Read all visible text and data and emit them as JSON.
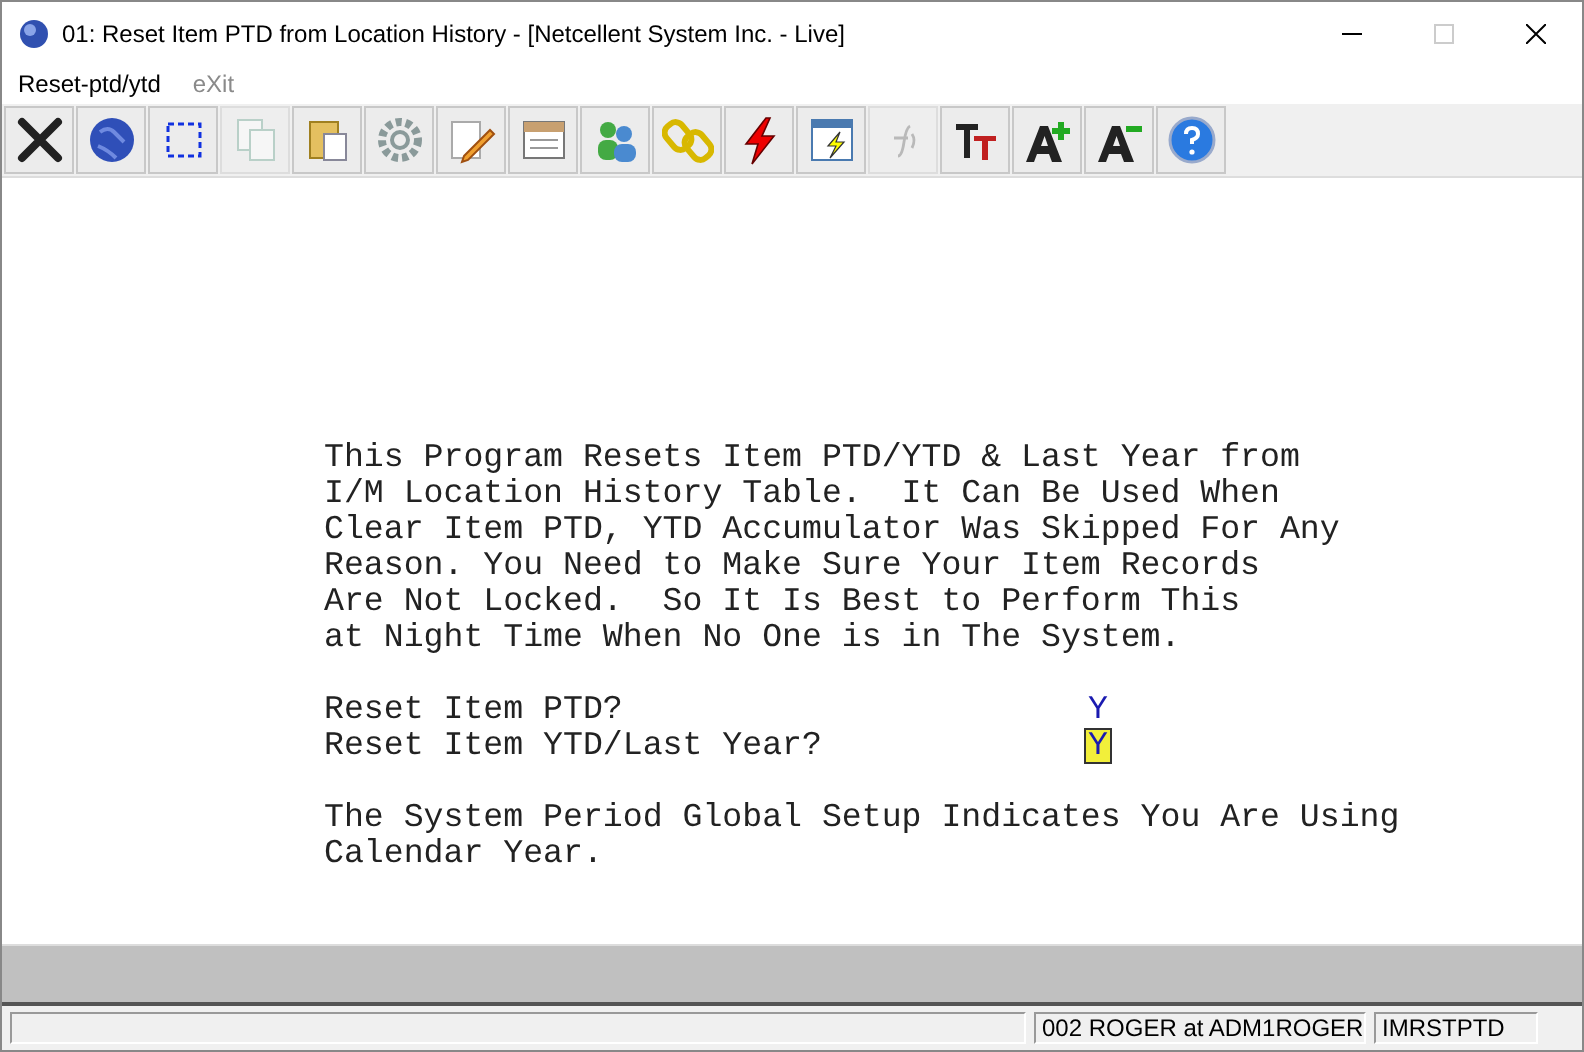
{
  "window": {
    "title": "01: Reset Item PTD from Location History - [Netcellent System Inc. - Live]"
  },
  "menu": [
    {
      "label": "Reset-ptd/ytd",
      "disabled": false
    },
    {
      "label": "eXit",
      "disabled": true
    }
  ],
  "toolbar": [
    {
      "kind": "close",
      "disabled": false
    },
    {
      "kind": "globe",
      "disabled": false
    },
    {
      "kind": "select",
      "disabled": false
    },
    {
      "kind": "copy",
      "disabled": true
    },
    {
      "kind": "paste",
      "disabled": false
    },
    {
      "kind": "gear",
      "disabled": false
    },
    {
      "kind": "edit",
      "disabled": false
    },
    {
      "kind": "notes",
      "disabled": false
    },
    {
      "kind": "users",
      "disabled": false
    },
    {
      "kind": "link",
      "disabled": false
    },
    {
      "kind": "bolt",
      "disabled": false
    },
    {
      "kind": "run",
      "disabled": false
    },
    {
      "kind": "fx",
      "disabled": true
    },
    {
      "kind": "font",
      "disabled": false
    },
    {
      "kind": "grow",
      "disabled": false
    },
    {
      "kind": "shrink",
      "disabled": false
    },
    {
      "kind": "help",
      "disabled": false
    }
  ],
  "intro": "This Program Resets Item PTD/YTD & Last Year from\nI/M Location History Table.  It Can Be Used When\nClear Item PTD, YTD Accumulator Was Skipped For Any\nReason. You Need to Make Sure Your Item Records\nAre Not Locked.  So It Is Best to Perform This\nat Night Time When No One is in The System.",
  "prompts": [
    {
      "label": "Reset Item PTD?",
      "value": "Y",
      "focused": false
    },
    {
      "label": "Reset Item YTD/Last Year?",
      "value": "Y",
      "focused": true
    }
  ],
  "note": "The System Period Global Setup Indicates You Are Using\nCalendar Year.",
  "status_bar": {
    "user": "002 ROGER at ADM1ROGER",
    "program": "IMRSTPTD"
  }
}
